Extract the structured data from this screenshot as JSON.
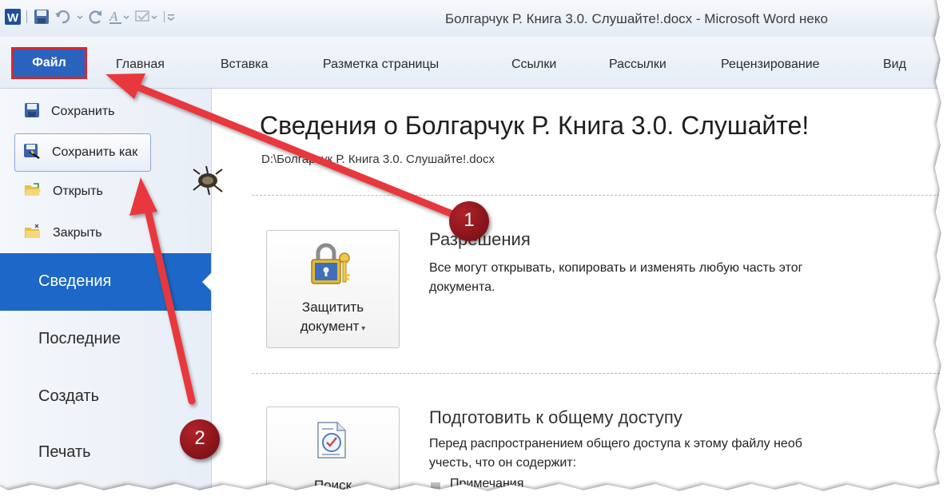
{
  "window": {
    "title": "Болгарчук Р.  Книга 3.0. Слушайте!.docx - Microsoft Word неко"
  },
  "ribbon": {
    "file_tab": "Файл",
    "tabs": [
      "Главная",
      "Вставка",
      "Разметка страницы",
      "Ссылки",
      "Рассылки",
      "Рецензирование",
      "Вид"
    ]
  },
  "backstage": {
    "commands": [
      {
        "label": "Сохранить",
        "icon": "save-icon"
      },
      {
        "label": "Сохранить как",
        "icon": "save-as-icon"
      },
      {
        "label": "Открыть",
        "icon": "open-folder-icon"
      },
      {
        "label": "Закрыть",
        "icon": "close-folder-icon"
      }
    ],
    "nav": [
      "Сведения",
      "Последние",
      "Создать",
      "Печать"
    ],
    "active_nav": "Сведения"
  },
  "info": {
    "heading": "Сведения о Болгарчук Р.  Книга 3.0. Слушайте!",
    "path": "D:\\Болгарчук Р.  Книга 3.0. Слушайте!.docx",
    "permissions": {
      "button_line1": "Защитить",
      "button_line2": "документ",
      "title": "Разрешения",
      "text_line1": "Все могут открывать, копировать и изменять любую часть этог",
      "text_line2": "документа."
    },
    "prepare": {
      "button_line1": "Поиск",
      "title": "Подготовить к общему доступу",
      "text_line1": "Перед распространением общего доступа к этому файлу необ",
      "text_line2": "учесть, что он содержит:",
      "bullet1": "Примечания"
    }
  },
  "annotations": {
    "badge1": "1",
    "badge2": "2",
    "arrow_color": "#e8393c",
    "badge_color": "#8b1119"
  }
}
